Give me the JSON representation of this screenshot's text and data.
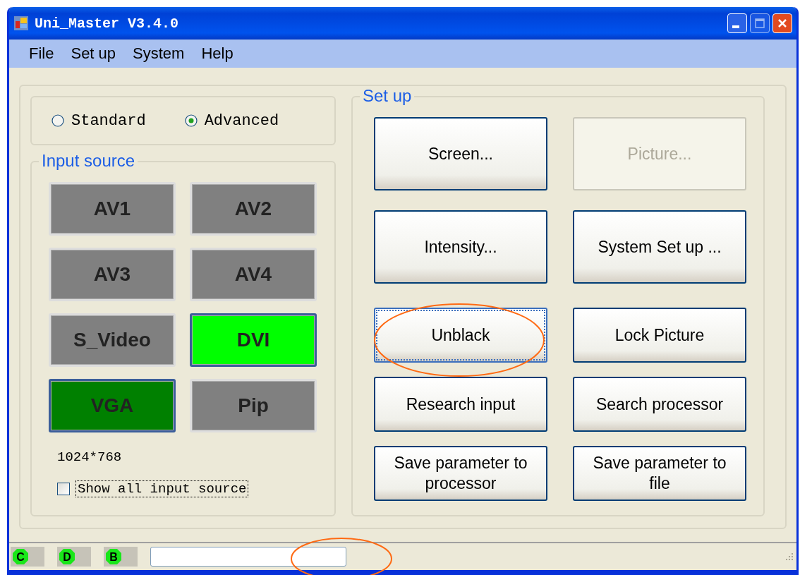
{
  "window": {
    "title": "Uni_Master V3.4.0"
  },
  "menu": [
    "File",
    "Set up",
    "System",
    "Help"
  ],
  "mode": [
    {
      "label": "Standard",
      "selected": false
    },
    {
      "label": "Advanced",
      "selected": true
    }
  ],
  "input_source": {
    "title": "Input source",
    "sources": [
      {
        "label": "AV1",
        "color": "#808080",
        "available": false
      },
      {
        "label": "AV2",
        "color": "#808080",
        "available": false
      },
      {
        "label": "AV3",
        "color": "#808080",
        "available": false
      },
      {
        "label": "AV4",
        "color": "#808080",
        "available": false
      },
      {
        "label": "S_Video",
        "color": "#808080",
        "available": false
      },
      {
        "label": "DVI",
        "color": "#00ff00",
        "available": true
      },
      {
        "label": "VGA",
        "color": "#008000",
        "available": true
      },
      {
        "label": "Pip",
        "color": "#808080",
        "available": false
      }
    ],
    "resolution": "1024*768",
    "show_all": {
      "label": "Show all input source",
      "checked": false
    }
  },
  "setup": {
    "title": "Set up",
    "buttons": [
      {
        "label": "Screen...",
        "disabled": false,
        "focused": false
      },
      {
        "label": "Picture...",
        "disabled": true,
        "focused": false
      },
      {
        "label": "Intensity...",
        "disabled": false,
        "focused": false
      },
      {
        "label": "System Set up ...",
        "disabled": false,
        "focused": false
      },
      {
        "label": "Unblack",
        "disabled": false,
        "focused": true
      },
      {
        "label": "Lock Picture",
        "disabled": false,
        "focused": false
      },
      {
        "label": "Research input",
        "disabled": false,
        "focused": false
      },
      {
        "label": "Search processor",
        "disabled": false,
        "focused": false
      },
      {
        "label": "Save parameter to processor",
        "disabled": false,
        "focused": false
      },
      {
        "label": "Save parameter to file",
        "disabled": false,
        "focused": false
      }
    ]
  },
  "status_bar": {
    "indicators": [
      "C",
      "D",
      "B"
    ]
  }
}
